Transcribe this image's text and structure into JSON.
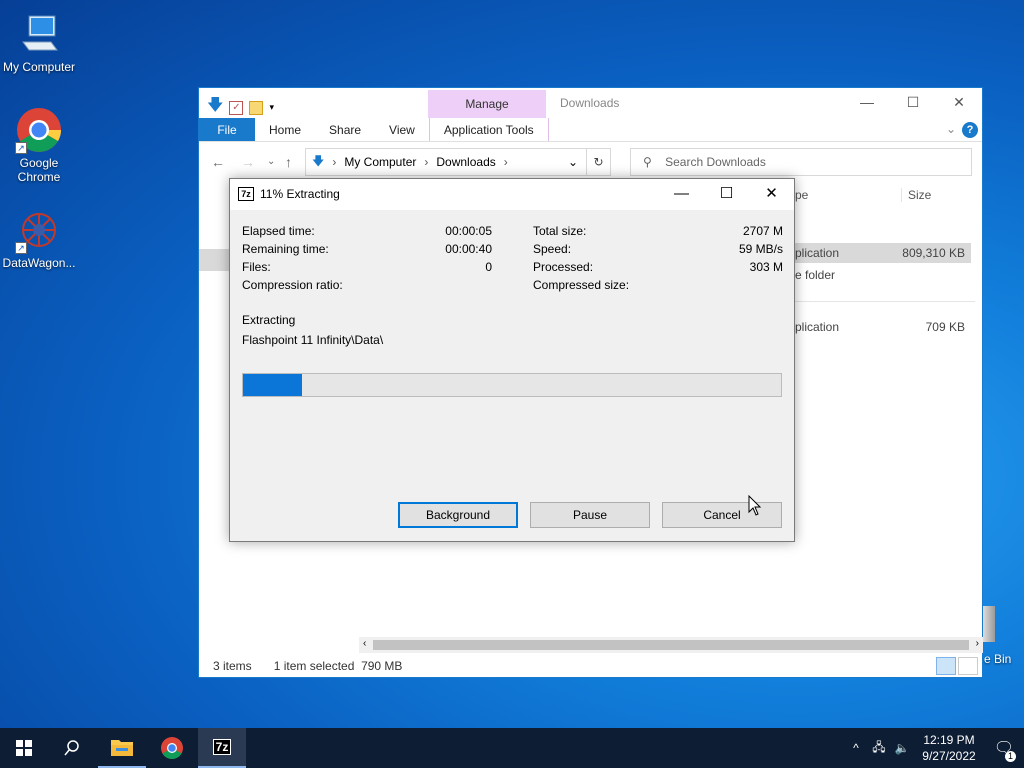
{
  "desktop": {
    "icons": [
      {
        "label": "My Computer",
        "icon": "monitor-icon"
      },
      {
        "label": "Google Chrome",
        "icon": "chrome-icon"
      },
      {
        "label": "DataWagon...",
        "icon": "datawagon-icon"
      }
    ],
    "recycle_bin_partial": "e Bin"
  },
  "explorer": {
    "contextual_tab": "Manage",
    "title": "Downloads",
    "ribbon_tabs": [
      "File",
      "Home",
      "Share",
      "View",
      "Application Tools"
    ],
    "address": {
      "root": "My Computer",
      "folder": "Downloads"
    },
    "search_placeholder": "Search Downloads",
    "columns": {
      "type_partial": "pe",
      "size": "Size"
    },
    "rows": [
      {
        "type": "plication",
        "size": "809,310 KB",
        "selected": true
      },
      {
        "type": "e folder",
        "size": ""
      },
      {
        "type": "plication",
        "size": "709 KB"
      }
    ],
    "status": {
      "items": "3 items",
      "selected": "1 item selected",
      "size": "790 MB"
    }
  },
  "dialog": {
    "title": "11% Extracting",
    "app_icon_text": "7z",
    "left_stats": [
      {
        "label": "Elapsed time:",
        "value": "00:00:05"
      },
      {
        "label": "Remaining time:",
        "value": "00:00:40"
      },
      {
        "label": "Files:",
        "value": "0"
      },
      {
        "label": "Compression ratio:",
        "value": ""
      }
    ],
    "right_stats": [
      {
        "label": "Total size:",
        "value": "2707 M"
      },
      {
        "label": "Speed:",
        "value": "59 MB/s"
      },
      {
        "label": "Processed:",
        "value": "303 M"
      },
      {
        "label": "Compressed size:",
        "value": ""
      }
    ],
    "status_label": "Extracting",
    "current_path": "Flashpoint 11 Infinity\\Data\\",
    "progress_percent": 11,
    "buttons": {
      "background": "Background",
      "pause": "Pause",
      "cancel": "Cancel"
    }
  },
  "taskbar": {
    "apps": [
      "start-icon",
      "search-icon",
      "file-explorer-icon",
      "chrome-icon",
      "7zip-icon"
    ],
    "active_app_label": "7z",
    "time": "12:19 PM",
    "date": "9/27/2022",
    "notification_count": "1"
  },
  "colors": {
    "accent": "#1979ca",
    "progress": "#0b76d8",
    "manage_tab": "#eecff7"
  }
}
